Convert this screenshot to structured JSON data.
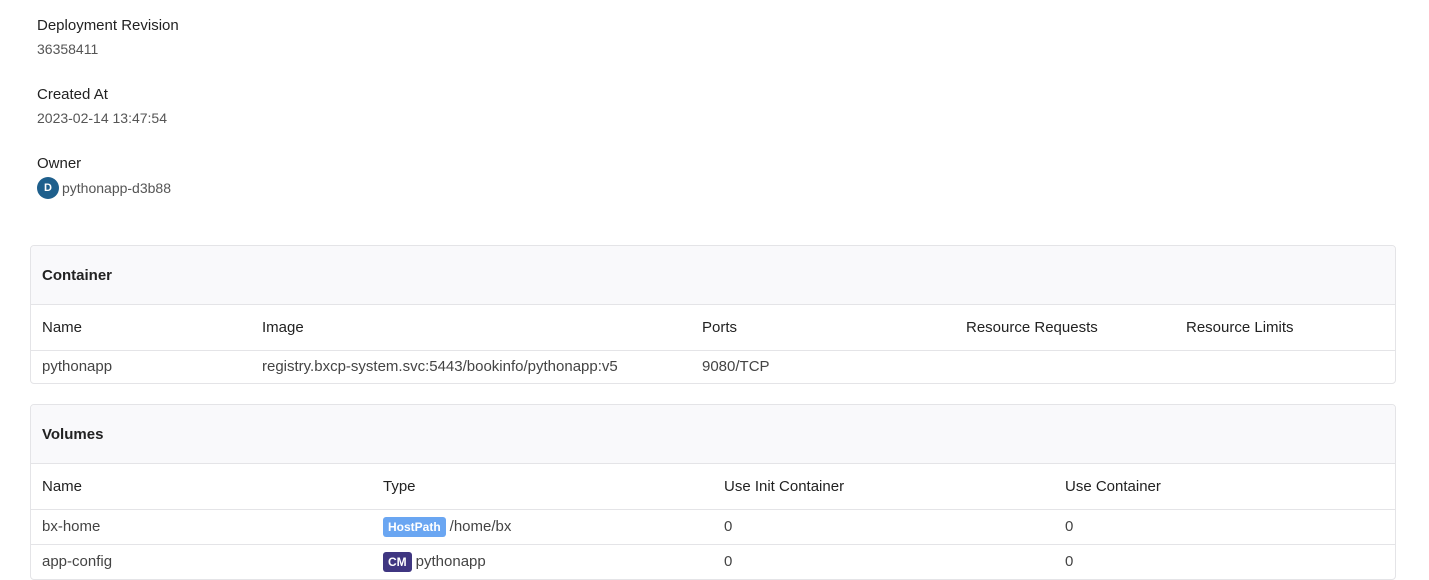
{
  "meta": {
    "revision_label": "Deployment Revision",
    "revision_value": "36358411",
    "created_label": "Created At",
    "created_value": "2023-02-14 13:47:54",
    "owner_label": "Owner",
    "owner_avatar": "D",
    "owner_value": "pythonapp-d3b88"
  },
  "container": {
    "title": "Container",
    "headers": [
      "Name",
      "Image",
      "Ports",
      "Resource Requests",
      "Resource Limits"
    ],
    "rows": [
      {
        "name": "pythonapp",
        "image": "registry.bxcp-system.svc:5443/bookinfo/pythonapp:v5",
        "ports": "9080/TCP",
        "requests": "",
        "limits": ""
      }
    ]
  },
  "volumes": {
    "title": "Volumes",
    "headers": [
      "Name",
      "Type",
      "Use Init Container",
      "Use Container"
    ],
    "rows": [
      {
        "name": "bx-home",
        "type_tag": "HostPath",
        "type_value": "/home/bx",
        "init": "0",
        "use": "0"
      },
      {
        "name": "app-config",
        "type_tag": "CM",
        "type_value": "pythonapp",
        "init": "0",
        "use": "0"
      }
    ]
  },
  "colors": {
    "avatar": "#1e5f8c",
    "hostpath_tag": "#6aa6f2",
    "cm_tag": "#3f3681"
  }
}
